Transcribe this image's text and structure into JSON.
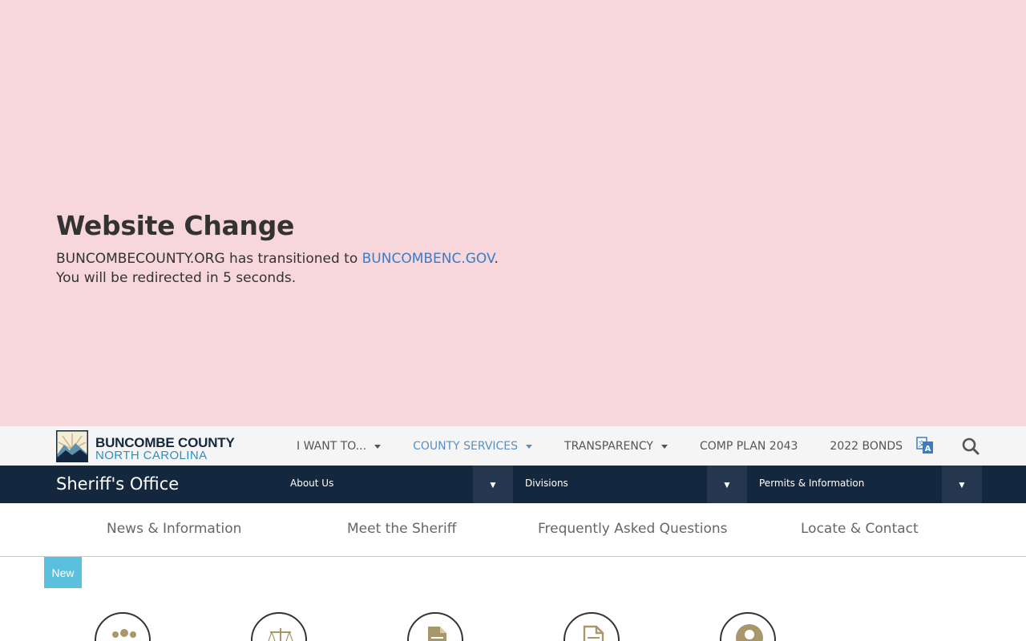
{
  "notice": {
    "title": "Website Change",
    "line1_prefix": "BUNCOMBECOUNTY.ORG has transitioned to ",
    "link_text": "BUNCOMBENC.GOV",
    "line1_suffix": ".",
    "line2": "You will be redirected in 5 seconds."
  },
  "header": {
    "logo_line1": "BUNCOMBE COUNTY",
    "logo_line2": "NORTH CAROLINA",
    "nav": [
      {
        "label": "I WANT TO...",
        "has_dropdown": true
      },
      {
        "label": "COUNTY SERVICES",
        "has_dropdown": true,
        "active": true
      },
      {
        "label": "TRANSPARENCY",
        "has_dropdown": true
      },
      {
        "label": "COMP PLAN 2043",
        "has_dropdown": false
      },
      {
        "label": "2022 BONDS",
        "has_dropdown": false
      }
    ],
    "translate_icon": "translate-icon",
    "search_icon": "search-icon"
  },
  "department": {
    "title": "Sheriff's Office",
    "menus": [
      {
        "label": "About Us",
        "toggle": "▼"
      },
      {
        "label": "Divisions",
        "toggle": "▼"
      },
      {
        "label": "Permits & Information",
        "toggle": "▼"
      }
    ]
  },
  "subnav": {
    "items": [
      "News & Information",
      "Meet the Sheriff",
      "Frequently Asked Questions",
      "Locate & Contact"
    ]
  },
  "badge": {
    "label": "New"
  },
  "icons": [
    "people-icon",
    "scales-icon",
    "document-icon",
    "form-icon",
    "person-icon"
  ],
  "colors": {
    "notice_bg": "#f7d7db",
    "link": "#3a7cc6",
    "navy": "#13283f",
    "gold": "#a8976a",
    "badge": "#5bc0de"
  }
}
